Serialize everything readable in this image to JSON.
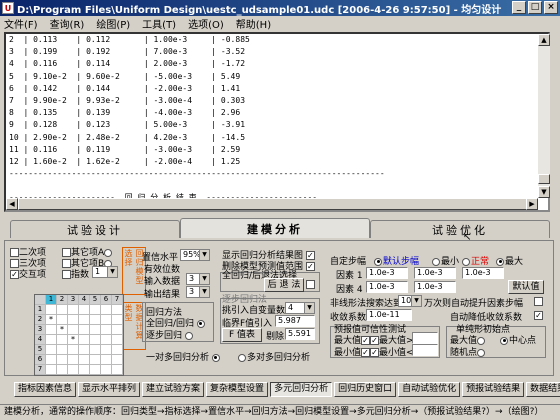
{
  "window": {
    "title": "D:\\Program Files\\Uniform Design\\uestc_udsample01.udc [2006-4-26 9:57:50] - 均匀设计"
  },
  "menu": [
    "文件(F)",
    "查询(R)",
    "绘图(P)",
    "工具(T)",
    "选项(O)",
    "帮助(H)"
  ],
  "editor": {
    "lines": [
      "2  | 0.113    | 0.112       | 1.00e-3     | -0.885",
      "3  | 0.199    | 0.192       | 7.00e-3     | -3.52",
      "4  | 0.116    | 0.114       | 2.00e-3     | -1.72",
      "5  | 9.10e-2  | 9.60e-2     | -5.00e-3    | 5.49",
      "6  | 0.142    | 0.144       | -2.00e-3    | 1.41",
      "7  | 9.90e-2  | 9.93e-2     | -3.00e-4    | 0.303",
      "8  | 0.135    | 0.139       | -4.00e-3    | 2.96",
      "9  | 0.128    | 0.123       | 5.00e-3     | -3.91",
      "10 | 2.90e-2  | 2.48e-2     | 4.20e-3     | -14.5",
      "11 | 0.116    | 0.119       | -3.00e-3    | 2.59",
      "12 | 1.60e-2  | 1.62e-2     | -2.00e-4    | 1.25",
      "------------------------------------------------------------------------------",
      "",
      "----------------------  回 归 分 析 结 束  -----------------------"
    ]
  },
  "tabs": {
    "design": "试验设计",
    "regression": "建模分析",
    "optimize": "试验优化"
  },
  "left": {
    "quadratic": "二次项",
    "other_a": "其它项A",
    "cubic": "三次项",
    "other_b": "其它项B",
    "interaction": "交互项",
    "index_label": "指数",
    "index_value": "1",
    "vbox1": "回归模型选择",
    "vbox2": "数据计算类型",
    "grid_headers": [
      "",
      "1",
      "2",
      "3",
      "4",
      "5",
      "6",
      "7"
    ],
    "grid_marks": [
      [
        2,
        1,
        "*"
      ],
      [
        3,
        2,
        "*"
      ],
      [
        4,
        3,
        "*"
      ]
    ]
  },
  "mid": {
    "confidence_label": "置信水平",
    "confidence_value": "95%",
    "digits_label": "有效位数",
    "input_label": "输入数据",
    "input_value": "3",
    "output_label": "输出结果",
    "output_value": "3",
    "method_group": "回归方法",
    "method_all": "全回归/回归",
    "method_step": "逐步回归",
    "one_to_many": "一对多回归分析",
    "many_to_many": "多对多回归分析"
  },
  "center": {
    "show_chart": "显示回归分析结果图",
    "del_outlier": "删除模型预测值范围",
    "group_title": "全回归/后退法选择",
    "back_btn": "后 退 法",
    "step_group": "逐步回归法",
    "var_label": "挑引入自变量数",
    "var_value": "4",
    "f_label": "临界F值",
    "f_in": "引入",
    "f_in_value": "5.987",
    "f_btn": "F 值表",
    "f_out": "剔除",
    "f_out_value": "5.591"
  },
  "right": {
    "step_label": "自定步幅",
    "default_step": "默认步幅",
    "min": "最小",
    "normal": "正常",
    "max": "最大",
    "factor1": "因素 1",
    "f1v": "1.0e-3",
    "f2v": "1.0e-3",
    "f3v": "1.0e-3",
    "factor4": "因素 4",
    "f4v": "1.0e-3",
    "f5v": "1.0e-3",
    "default_val": "默认值",
    "nonlinear_label": "非线形法搜索达到",
    "nonlinear_value": "10",
    "auto_label": "万次则自动提升因素步幅",
    "converge_label": "收敛系数",
    "converge_value": "1.0e-11",
    "auto_down": "自动降低收敛系数",
    "pred_group": "预报值可信性测试",
    "max_val": "最大值",
    "max_val2": "最大值>",
    "min_val": "最小值",
    "min_val2": "最小值<",
    "shape_group": "单纯形初始点",
    "shape_max": "最大值",
    "shape_center": "中心点",
    "random": "随机点"
  },
  "bottom_buttons": [
    "指标因素信息",
    "显示水平排列",
    "建立试验方案",
    "复杂模型设置",
    "多元回归分析",
    "回归历史窗口",
    "自动试验优化",
    "预报试验结果",
    "数据结果绘图"
  ],
  "active_bottom": 4,
  "status": "建模分析，通常的操作顺序：回归类型→指标选择→置信水平→回归方法→回归模型设置→多元回归分析→（预报试验结果?）→（绘图?）"
}
